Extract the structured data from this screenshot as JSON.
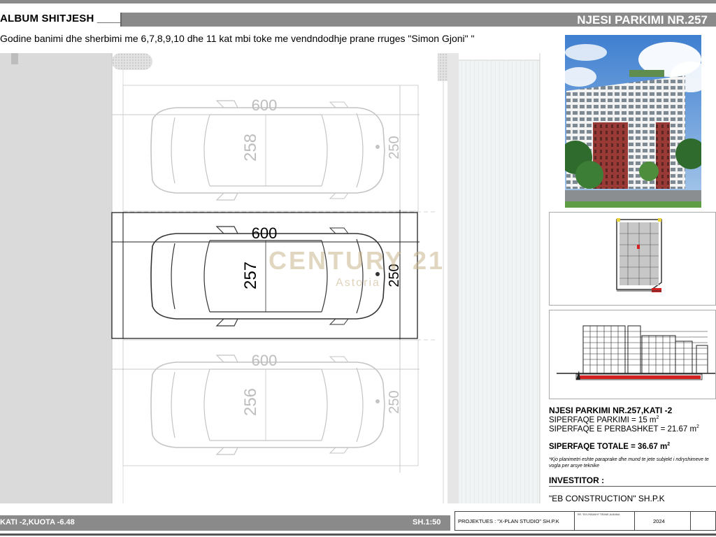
{
  "header": {
    "album_title": "ALBUM SHITJESH ____",
    "unit_title": "NJESI PARKIMI NR.257",
    "description": "Godine banimi dhe sherbimi me 6,7,8,9,10 dhe 11 kat mbi toke me vendndodhje prane rruges \"Simon Gjoni\" \""
  },
  "plan": {
    "spaces": [
      {
        "number": "258",
        "length": "600",
        "width": "250",
        "highlighted": false
      },
      {
        "number": "257",
        "length": "600",
        "width": "250",
        "highlighted": true
      },
      {
        "number": "256",
        "length": "600",
        "width": "250",
        "highlighted": false
      }
    ],
    "watermark": {
      "brand": "CENTURY 21",
      "office": "Astoria"
    }
  },
  "info": {
    "title": "NJESI PARKIMI NR.257,KATI -2",
    "parking_area": "SIPERFAQE PARKIMI = 15 m",
    "common_area": "SIPERFAQE E PERBASHKET = 21.67 m",
    "area_unit_exponent": "2",
    "total_area": "SIPERFAQE TOTALE = 36.67 m",
    "note": "*Kjo planimetri eshte paraprake dhe mund te jete subjekt i ndryshimeve te vogla per arsye teknike",
    "investor_label": "INVESTITOR :",
    "investor_name": "\"EB CONSTRUCTION\" SH.P.K"
  },
  "footer": {
    "level": "KATI -2,KUOTA -6.48",
    "scale": "SH.1:50",
    "project": "PROJEKTUES : \"X-PLAN STUDIO\" SH.P.K",
    "year": "2024",
    "small_lines": [
      "RR. \"BYLYKBASHI\" TIRANE,ALBANIA"
    ]
  },
  "colors": {
    "header_gray": "#8a8a8a",
    "highlight_red": "#d42020",
    "watermark_gold": "#c9b48a"
  },
  "icons": {
    "car": "car-topview-icon"
  }
}
